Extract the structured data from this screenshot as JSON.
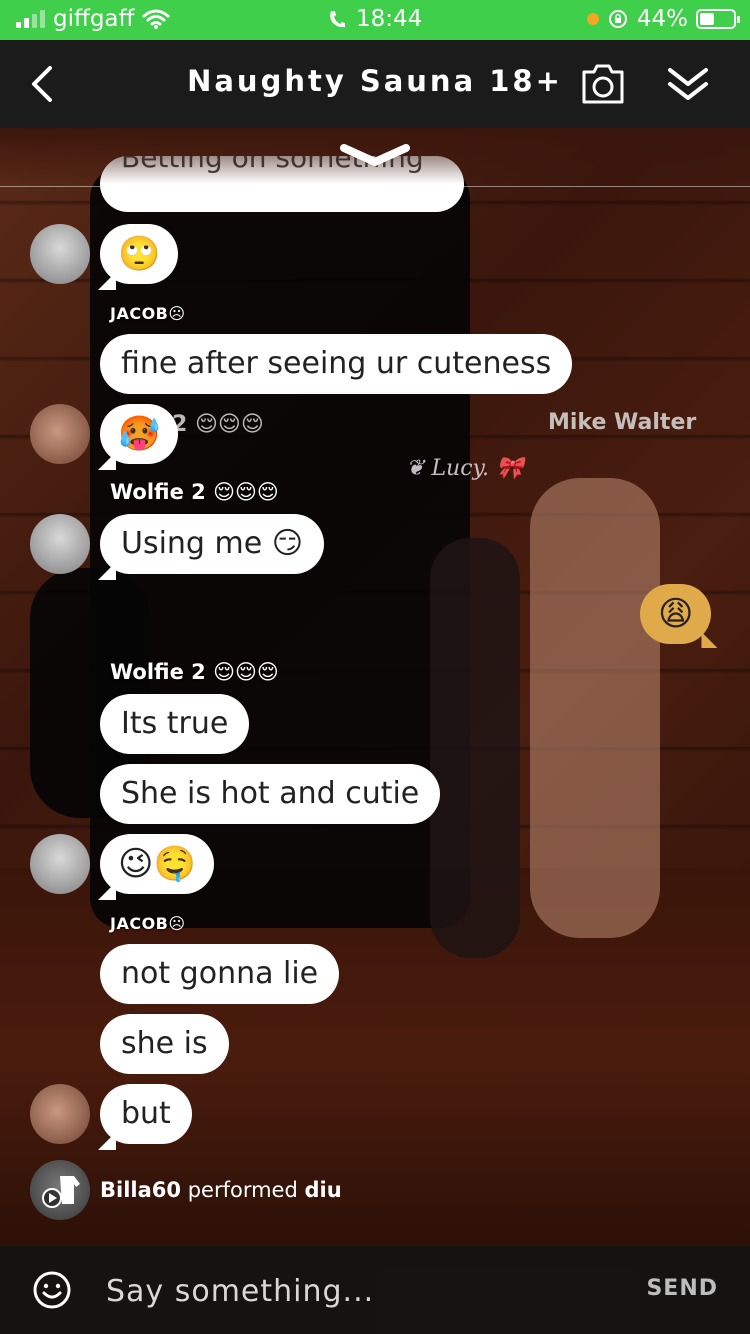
{
  "status_bar": {
    "carrier": "giffgaff",
    "time": "18:44",
    "battery": "44%",
    "battery_level": 0.44
  },
  "header": {
    "title": "Naughty Sauna 18+",
    "back_icon": "chevron-left-icon",
    "camera_icon": "camera-icon",
    "collapse_icon": "double-chevron-down-icon"
  },
  "scene": {
    "overlay_names": [
      "Mike Walter"
    ],
    "overlay_lucy": "Lucy."
  },
  "chat": {
    "partial_message": "Betting on something",
    "messages": [
      {
        "text": "🙄"
      },
      {
        "username": "JACOB☹"
      },
      {
        "text": "fine after seeing ur cuteness"
      },
      {
        "text": "🥵"
      },
      {
        "username": "Wolfie 2 😌😌😌"
      },
      {
        "text": "Using me 😏"
      },
      {
        "text": "😩"
      },
      {
        "username": "Wolfie 2 😌😌😌"
      },
      {
        "text": "Its true"
      },
      {
        "text": "She is hot and cutie"
      },
      {
        "text": "😉🤤"
      },
      {
        "username": "JACOB☹"
      },
      {
        "text": "not gonna lie"
      },
      {
        "text": "she is"
      },
      {
        "text": "but"
      }
    ],
    "ghost_username_fragment": "2 😌😌😌",
    "system": {
      "user": "Billa60",
      "verb": "performed",
      "action": "diu"
    }
  },
  "input": {
    "placeholder": "Say something...",
    "send_label": "SEND",
    "emoji_icon": "smiley-icon"
  }
}
